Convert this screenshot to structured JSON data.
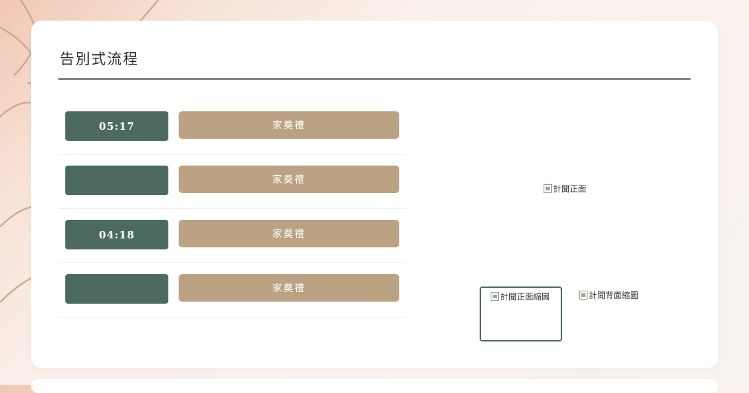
{
  "section": {
    "title": "告別式流程"
  },
  "schedule": [
    {
      "time": "05:17",
      "label": "家奠禮"
    },
    {
      "time": "",
      "label": "家奠禮"
    },
    {
      "time": "04:18",
      "label": "家奠禮"
    },
    {
      "time": "",
      "label": "家奠禮"
    }
  ],
  "gallery": {
    "main_alt": "計聞正面",
    "thumbs": [
      {
        "alt": "計聞正面縮圖",
        "active": true
      },
      {
        "alt": "計聞背面縮圖",
        "active": false
      }
    ]
  },
  "colors": {
    "accent_green": "#4d6a62",
    "button_tan": "#bba282"
  }
}
